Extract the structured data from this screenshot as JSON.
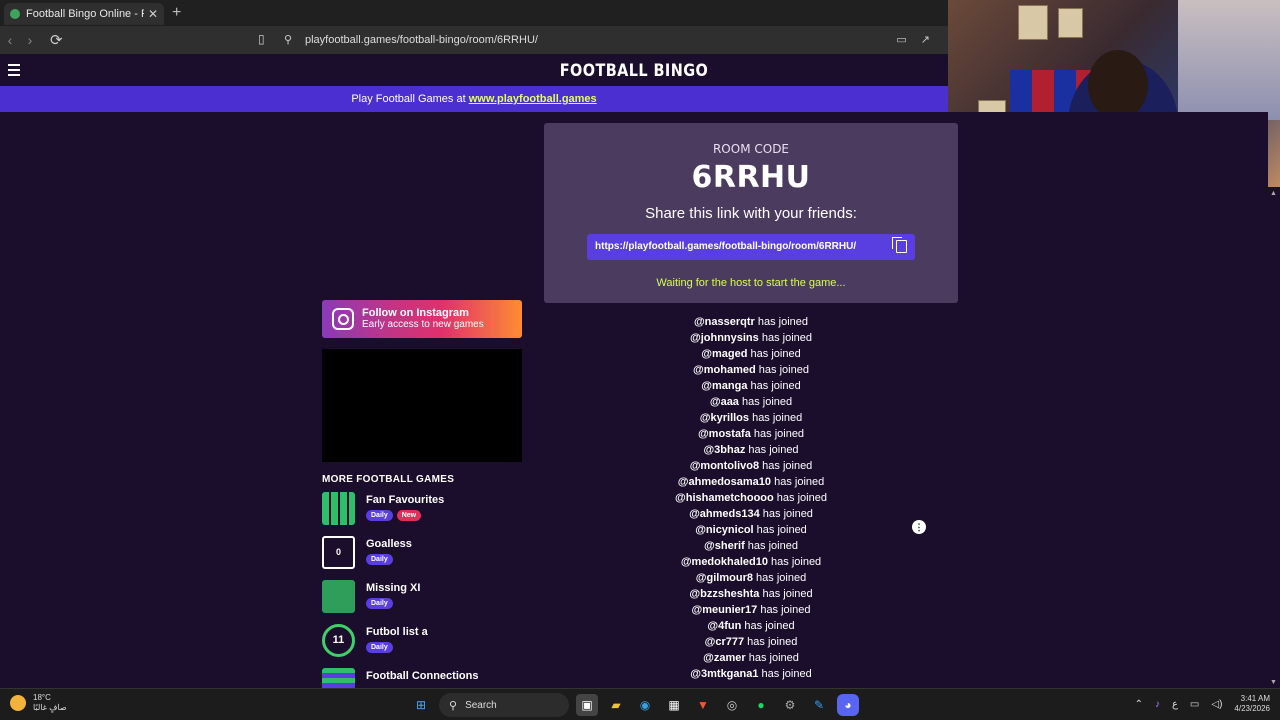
{
  "browser": {
    "tab_title": "Football Bingo Online - Play Now",
    "tab_close": "✕",
    "new_tab": "+",
    "url": "playfootball.games/football-bingo/room/6RRHU/"
  },
  "header": {
    "logo": "FOOTBALL BINGO",
    "promo_text": "Play Football Games at ",
    "promo_link": "www.playfootball.games"
  },
  "room": {
    "label": "ROOM CODE",
    "code": "6RRHU",
    "share_heading": "Share this link with your friends:",
    "share_link": "https://playfootball.games/football-bingo/room/6RRHU/",
    "status": "Waiting for the host to start the game..."
  },
  "instagram": {
    "title": "Follow on Instagram",
    "subtitle": "Early access to new games"
  },
  "more_games": {
    "heading": "MORE FOOTBALL GAMES",
    "items": [
      {
        "name": "Fan Favourites",
        "badges": [
          "Daily",
          "New"
        ]
      },
      {
        "name": "Goalless",
        "badges": [
          "Daily"
        ],
        "icon_text": "0"
      },
      {
        "name": "Missing XI",
        "badges": [
          "Daily"
        ]
      },
      {
        "name": "Futbol list a",
        "badges": [
          "Daily"
        ],
        "icon_text": "11"
      },
      {
        "name": "Football Connections",
        "badges": []
      }
    ]
  },
  "joined_suffix": " has joined",
  "players": [
    "@nasserqtr",
    "@johnnysins",
    "@maged",
    "@mohamed",
    "@manga",
    "@aaa",
    "@kyrillos",
    "@mostafa",
    "@3bhaz",
    "@montolivo8",
    "@ahmedosama10",
    "@hishametchoooo",
    "@ahmeds134",
    "@nicynicol",
    "@sherif",
    "@medokhaled10",
    "@gilmour8",
    "@bzzsheshta",
    "@meunier17",
    "@4fun",
    "@cr777",
    "@zamer",
    "@3mtkgana1"
  ],
  "taskbar": {
    "temperature": "18°C",
    "weather_desc": "صافٍ غالبًا",
    "search": "Search",
    "lang": "ع",
    "time": "3:41 AM",
    "date": "4/23/2026"
  },
  "colors": {
    "background": "#1b0e2c",
    "promo_bar": "#4b2fd0",
    "card": "#4b3b5e",
    "accent_link": "#e3ff5a",
    "status_text": "#d6ff4a"
  }
}
